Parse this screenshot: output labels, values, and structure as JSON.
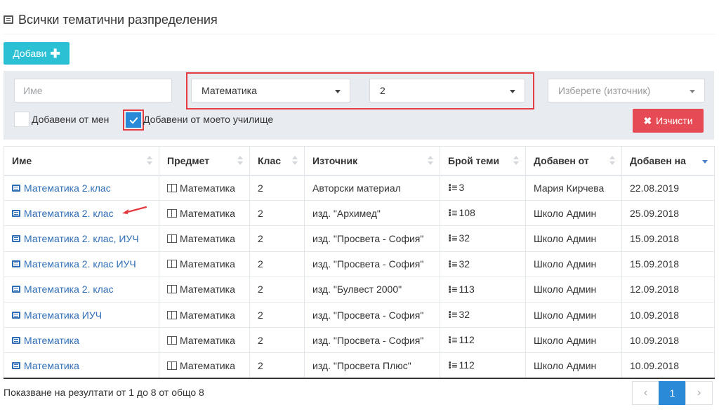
{
  "header": {
    "title": "Всички тематични разпределения"
  },
  "toolbar": {
    "add_label": "Добави"
  },
  "filters": {
    "name_placeholder": "Име",
    "subject_value": "Математика",
    "grade_value": "2",
    "source_placeholder": "Изберете (източник)",
    "added_by_me_label": "Добавени от мен",
    "added_by_me_checked": false,
    "added_by_school_label": "Добавени от моето училище",
    "added_by_school_checked": true,
    "clear_label": "Изчисти"
  },
  "table": {
    "columns": [
      "Име",
      "Предмет",
      "Клас",
      "Източник",
      "Брой теми",
      "Добавен от",
      "Добавен на"
    ],
    "sorted_column": "Добавен на",
    "sort_direction": "desc",
    "rows": [
      {
        "name": "Математика 2.клас",
        "subject": "Математика",
        "grade": "2",
        "source": "Авторски материал",
        "topics": "3",
        "added_by": "Мария Кирчева",
        "added_on": "22.08.2019"
      },
      {
        "name": "Математика 2. клас",
        "subject": "Математика",
        "grade": "2",
        "source": "изд. \"Архимед\"",
        "topics": "108",
        "added_by": "Школо Админ",
        "added_on": "25.09.2018"
      },
      {
        "name": "Математика 2. клас, ИУЧ",
        "subject": "Математика",
        "grade": "2",
        "source": "изд. \"Просвета - София\"",
        "topics": "32",
        "added_by": "Школо Админ",
        "added_on": "15.09.2018"
      },
      {
        "name": "Математика 2. клас ИУЧ",
        "subject": "Математика",
        "grade": "2",
        "source": "изд. \"Просвета - София\"",
        "topics": "32",
        "added_by": "Школо Админ",
        "added_on": "15.09.2018"
      },
      {
        "name": "Математика 2. клас",
        "subject": "Математика",
        "grade": "2",
        "source": "изд. \"Булвест 2000\"",
        "topics": "113",
        "added_by": "Школо Админ",
        "added_on": "12.09.2018"
      },
      {
        "name": "Математика ИУЧ",
        "subject": "Математика",
        "grade": "2",
        "source": "изд. \"Просвета - София\"",
        "topics": "32",
        "added_by": "Школо Админ",
        "added_on": "10.09.2018"
      },
      {
        "name": "Математика",
        "subject": "Математика",
        "grade": "2",
        "source": "изд. \"Просвета - София\"",
        "topics": "112",
        "added_by": "Школо Админ",
        "added_on": "10.09.2018"
      },
      {
        "name": "Математика",
        "subject": "Математика",
        "grade": "2",
        "source": "изд. \"Просвета Плюс\"",
        "topics": "112",
        "added_by": "Школо Админ",
        "added_on": "10.09.2018"
      }
    ]
  },
  "footer": {
    "info": "Показване на резултати от 1 до 8 от общо 8",
    "current_page": "1",
    "prev_symbol": "‹",
    "next_symbol": "›"
  },
  "colors": {
    "accent": "#2a8ad8",
    "add_button": "#2bc0d3",
    "clear_button": "#e64a55",
    "link": "#2d6db5",
    "highlight": "#e53b43"
  },
  "icons": {
    "header": "list-alt-icon",
    "add": "plus-icon",
    "clear": "times-icon",
    "row_name": "list-alt-icon",
    "row_subject": "book-icon",
    "row_topics": "ordered-list-icon"
  }
}
